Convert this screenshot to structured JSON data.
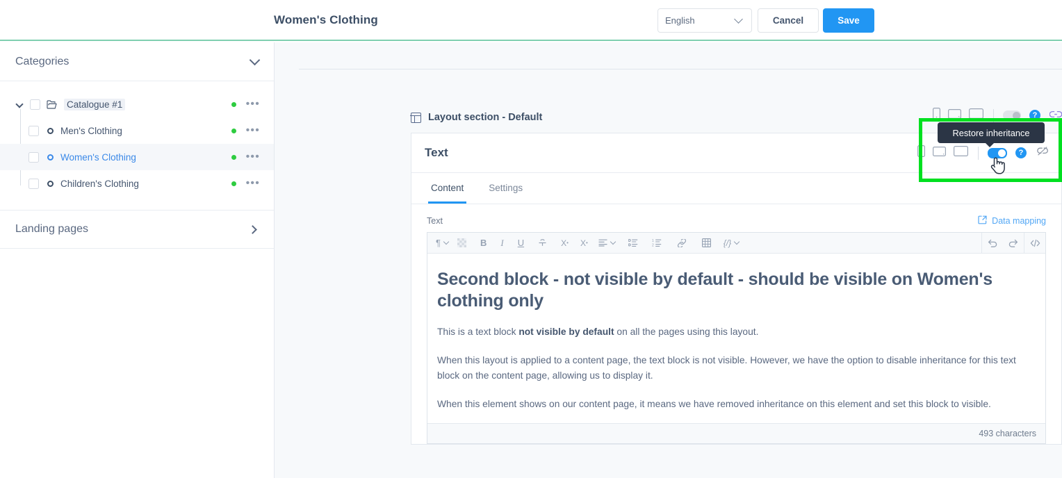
{
  "header": {
    "page_title": "Women's Clothing",
    "language_value": "English",
    "language_icon": "chevron-down-icon",
    "cancel_label": "Cancel",
    "save_label": "Save",
    "accent_color": "#2196f3",
    "underline_color": "#7fcfb0"
  },
  "sidebar": {
    "categories_label": "Categories",
    "categories_icon": "chevron-down-icon",
    "landing_pages_label": "Landing pages",
    "landing_pages_icon": "chevron-right-icon",
    "status_dot_color": "#2ecc40",
    "tree": [
      {
        "label": "Catalogue #1",
        "level": 1,
        "icon": "folder-icon",
        "expanded": true,
        "selected": false,
        "highlighted": true,
        "status": "active",
        "menu_icon": "ellipsis-icon"
      },
      {
        "label": "Men's Clothing",
        "level": 2,
        "icon": "circle-node-icon",
        "selected": false,
        "status": "active",
        "menu_icon": "ellipsis-icon"
      },
      {
        "label": "Women's Clothing",
        "level": 2,
        "icon": "circle-node-icon",
        "selected": true,
        "status": "active",
        "menu_icon": "ellipsis-icon"
      },
      {
        "label": "Children's Clothing",
        "level": 2,
        "icon": "circle-node-icon",
        "selected": false,
        "status": "active",
        "menu_icon": "ellipsis-icon"
      }
    ]
  },
  "layout_section": {
    "title": "Layout section - Default",
    "icon": "layout-columns-icon",
    "devices": [
      "mobile-icon",
      "tablet-icon",
      "desktop-icon"
    ],
    "inheritance_toggle": "off",
    "help_icon": "help-circle-icon",
    "link_icon": "link-icon"
  },
  "block": {
    "title": "Text",
    "devices": [
      "mobile-icon",
      "tablet-icon",
      "desktop-icon"
    ],
    "inheritance_toggle": "on",
    "help_icon": "help-circle-icon",
    "link_icon": "broken-link-icon",
    "tabs": [
      {
        "label": "Content",
        "active": true
      },
      {
        "label": "Settings",
        "active": false
      }
    ],
    "field_label": "Text",
    "data_mapping_label": "Data mapping",
    "data_mapping_icon": "external-link-icon",
    "toolbar": {
      "left_items": [
        {
          "name": "paragraph-format",
          "glyph": "¶",
          "has_caret": true
        },
        {
          "name": "clear-format",
          "glyph": "░",
          "has_caret": false
        },
        {
          "name": "bold",
          "glyph": "B",
          "has_caret": false
        },
        {
          "name": "italic",
          "glyph": "I",
          "has_caret": false
        },
        {
          "name": "underline",
          "glyph": "U",
          "has_caret": false
        },
        {
          "name": "strikethrough",
          "glyph": "S",
          "has_caret": false
        },
        {
          "name": "superscript",
          "glyph": "X",
          "has_caret": false
        },
        {
          "name": "subscript",
          "glyph": "X",
          "has_caret": false
        },
        {
          "name": "align",
          "glyph": "≡",
          "has_caret": true
        },
        {
          "name": "bulleted-list",
          "glyph": "•≡",
          "has_caret": false
        },
        {
          "name": "numbered-list",
          "glyph": "1≡",
          "has_caret": false
        },
        {
          "name": "insert-link",
          "glyph": "ὑ7",
          "has_caret": false
        },
        {
          "name": "insert-table",
          "glyph": "⊞",
          "has_caret": false
        },
        {
          "name": "insert-code",
          "glyph": "{/}",
          "has_caret": true
        }
      ],
      "undo_icon": "undo-icon",
      "redo_icon": "redo-icon",
      "source_icon": "source-code-icon"
    },
    "content": {
      "heading": "Second block - not visible by default - should be visible on Women's clothing only",
      "p1_before": "This is a text block ",
      "p1_bold": "not visible by default",
      "p1_after": " on all the pages using this layout.",
      "p2": "When this layout is applied to a content page, the text block is not visible. However, we have the option to disable inheritance for this text block on the content page, allowing us to display it.",
      "p3": "When this element shows on our content page, it means we have removed inheritance on this element and set this block to visible."
    },
    "character_count": "493 characters"
  },
  "overlay": {
    "tooltip_text": "Restore inheritance",
    "highlight_color": "#00e020",
    "tooltip_bg": "#2b3545",
    "cursor_icon": "pointer-hand-cursor"
  }
}
